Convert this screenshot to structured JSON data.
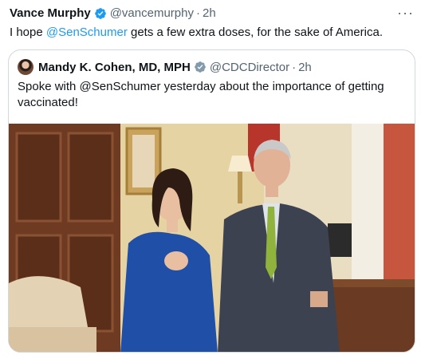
{
  "tweet": {
    "author_name": "Vance Murphy",
    "author_handle": "@vancemurphy",
    "separator": "·",
    "time": "2h",
    "more_label": "···",
    "text_before": "I hope ",
    "mention": "@SenSchumer",
    "text_after": " gets a few extra doses, for the sake of America."
  },
  "quoted": {
    "author_name": "Mandy K. Cohen, MD, MPH",
    "author_handle": "@CDCDirector",
    "separator": "·",
    "time": "2h",
    "text": "Spoke with @SenSchumer yesterday about the importance of getting vaccinated!"
  },
  "colors": {
    "verified_blue": "#1d9bf0",
    "mention_blue": "#1d9bf0",
    "secondary_text": "#536471"
  },
  "icons": {
    "verified": "verified-badge-icon",
    "more": "more-options-icon"
  }
}
